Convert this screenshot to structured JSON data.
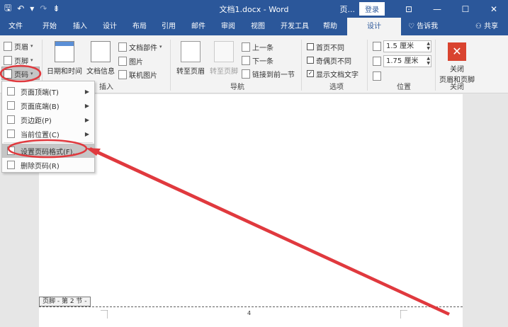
{
  "window": {
    "title": "文档1.docx  -  Word",
    "context_hint": "页...",
    "login_label": "登录",
    "controls": {
      "ribbon_options": "⊡",
      "minimize": "—",
      "restore": "☐",
      "close": "✕"
    }
  },
  "qat": {
    "save": "🖫",
    "undo": "↶",
    "undo_caret": "▾",
    "redo": "↷",
    "customize": "⇟"
  },
  "tabs": [
    {
      "label": "文件"
    },
    {
      "label": "开始"
    },
    {
      "label": "插入"
    },
    {
      "label": "设计"
    },
    {
      "label": "布局"
    },
    {
      "label": "引用"
    },
    {
      "label": "邮件"
    },
    {
      "label": "审阅"
    },
    {
      "label": "视图"
    },
    {
      "label": "开发工具"
    },
    {
      "label": "帮助"
    },
    {
      "label": "设计"
    }
  ],
  "tell_me": {
    "icon": "lightbulb-icon",
    "label": "告诉我"
  },
  "share": {
    "icon": "person-icon",
    "label": "共享"
  },
  "ribbon": {
    "hf_group": {
      "header": "页眉",
      "footer": "页脚",
      "page_number": "页码"
    },
    "insert_group": {
      "datetime": "日期和时间",
      "docinfo": "文档信息",
      "docparts": "文档部件",
      "picture": "图片",
      "online_picture": "联机图片",
      "label": "插入"
    },
    "nav_group": {
      "goto_header": "转至页眉",
      "goto_footer": "转至页脚",
      "previous": "上一条",
      "next": "下一条",
      "link_previous": "链接到前一节",
      "label": "导航"
    },
    "options_group": {
      "diff_first": "首页不同",
      "diff_odd_even": "奇偶页不同",
      "show_doc_text": "显示文档文字",
      "show_doc_text_checked": "✓",
      "label": "选项"
    },
    "position_group": {
      "header_pos": "1.5 厘米",
      "footer_pos": "1.75 厘米",
      "label": "位置"
    },
    "close_group": {
      "button": "关闭",
      "button_line2": "页眉和页脚",
      "icon": "✕",
      "label": "关闭"
    }
  },
  "menu": {
    "items": [
      {
        "label": "页面顶端(T)",
        "sub": "▶"
      },
      {
        "label": "页面底端(B)",
        "sub": "▶"
      },
      {
        "label": "页边距(P)",
        "sub": "▶"
      },
      {
        "label": "当前位置(C)",
        "sub": "▶"
      },
      {
        "label": "设置页码格式(F)..."
      },
      {
        "label": "删除页码(R)"
      }
    ]
  },
  "document": {
    "footer_tag": "页脚 - 第 2 节 -",
    "page_num_mark": "4"
  },
  "annotation_color": "#e0393e"
}
